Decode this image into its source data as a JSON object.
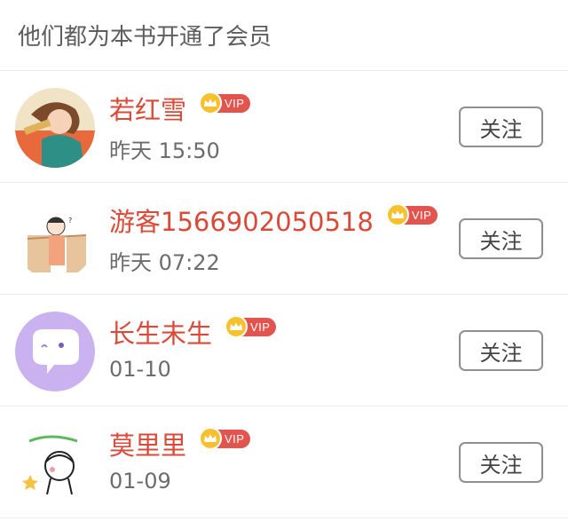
{
  "header": {
    "title": "他们都为本书开通了会员"
  },
  "members": [
    {
      "name": "若红雪",
      "badge": "VIP",
      "time": "昨天 15:50",
      "follow": "关注"
    },
    {
      "name": "游客1566902050518",
      "badge": "VIP",
      "time": "昨天 07:22",
      "follow": "关注"
    },
    {
      "name": "长生未生",
      "badge": "VIP",
      "time": "01-10",
      "follow": "关注"
    },
    {
      "name": "莫里里",
      "badge": "VIP",
      "time": "01-09",
      "follow": "关注"
    }
  ],
  "colors": {
    "name": "#d94a38",
    "vip_crown": "#f7c12e",
    "vip_tag": "#e2554f",
    "divider": "#ececec"
  },
  "icons": {
    "avatar_1": "cartoon-girl-avatar",
    "avatar_2": "child-with-curtain-avatar",
    "avatar_3": "purple-chat-bubble-avatar",
    "avatar_4": "sketch-girl-avatar",
    "vip": "crown-icon"
  }
}
